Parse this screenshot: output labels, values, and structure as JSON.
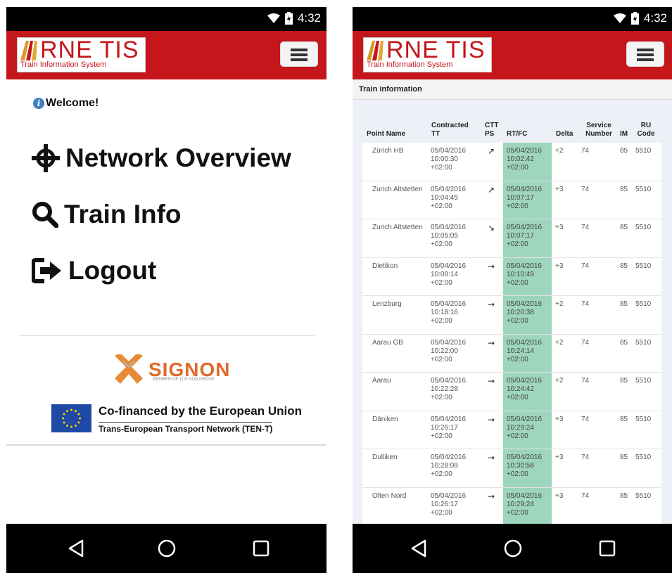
{
  "status": {
    "time": "4:32"
  },
  "logo": {
    "title": "RNE TIS",
    "subtitle": "Train Information System"
  },
  "left": {
    "welcome": "Welcome!",
    "menu": [
      {
        "label": "Network Overview",
        "icon": "crosshair-icon"
      },
      {
        "label": "Train Info",
        "icon": "search-icon"
      },
      {
        "label": "Logout",
        "icon": "logout-icon"
      }
    ],
    "sponsor": {
      "name": "SIGNON",
      "tagline": "MEMBER OF TÜV SÜD GROUP"
    },
    "eu": {
      "line1": "Co-financed by the European Union",
      "line2": "Trans-European Transport Network (TEN-T)"
    }
  },
  "right": {
    "section_title": "Train information",
    "headers": {
      "point": "Point Name",
      "contracted": "Contracted TT",
      "ctt": "CTT PS",
      "rtfc": "RT/FC",
      "delta": "Delta",
      "service": "Service Number",
      "im": "IM",
      "ru": "RU Code"
    },
    "rows": [
      {
        "point": "Zürich HB",
        "ctt_date": "05/04/2016",
        "ctt_time": "10:00:30",
        "ctt_tz": "+02:00",
        "arrow": "↗",
        "rt": "05/04/2016\n10:02:42\n+02:00",
        "delta": "+2",
        "service": "74",
        "im": "85",
        "ru": "5510"
      },
      {
        "point": "Zurich Altstetten",
        "ctt_date": "05/04/2016",
        "ctt_time": "10:04:45",
        "ctt_tz": "+02:00",
        "arrow": "↗",
        "rt": "05/04/2016\n10:07:17\n+02:00",
        "delta": "+3",
        "service": "74",
        "im": "85",
        "ru": "5510"
      },
      {
        "point": "Zurich Altstetten",
        "ctt_date": "05/04/2016",
        "ctt_time": "10:05:05",
        "ctt_tz": "+02:00",
        "arrow": "↘",
        "rt": "05/04/2016\n10:07:17\n+02:00",
        "delta": "+3",
        "service": "74",
        "im": "85",
        "ru": "5510"
      },
      {
        "point": "Dietikon",
        "ctt_date": "05/04/2016",
        "ctt_time": "10:08:14",
        "ctt_tz": "+02:00",
        "arrow": "→",
        "rt": "05/04/2016\n10:10:49\n+02:00",
        "delta": "+3",
        "service": "74",
        "im": "85",
        "ru": "5510"
      },
      {
        "point": "Lenzburg",
        "ctt_date": "05/04/2016",
        "ctt_time": "10:18:16",
        "ctt_tz": "+02:00",
        "arrow": "→",
        "rt": "05/04/2016\n10:20:38\n+02:00",
        "delta": "+2",
        "service": "74",
        "im": "85",
        "ru": "5510"
      },
      {
        "point": "Aarau GB",
        "ctt_date": "05/04/2016",
        "ctt_time": "10:22:00",
        "ctt_tz": "+02:00",
        "arrow": "→",
        "rt": "05/04/2016\n10:24:14\n+02:00",
        "delta": "+2",
        "service": "74",
        "im": "85",
        "ru": "5510"
      },
      {
        "point": "Aarau",
        "ctt_date": "05/04/2016",
        "ctt_time": "10:22:28",
        "ctt_tz": "+02:00",
        "arrow": "→",
        "rt": "05/04/2016\n10:24:42\n+02:00",
        "delta": "+2",
        "service": "74",
        "im": "85",
        "ru": "5510"
      },
      {
        "point": "Däniken",
        "ctt_date": "05/04/2016",
        "ctt_time": "10:26:17",
        "ctt_tz": "+02:00",
        "arrow": "→",
        "rt": "05/04/2016\n10:29:24\n+02:00",
        "delta": "+3",
        "service": "74",
        "im": "85",
        "ru": "5510"
      },
      {
        "point": "Dulliken",
        "ctt_date": "05/04/2016",
        "ctt_time": "10:28:09",
        "ctt_tz": "+02:00",
        "arrow": "→",
        "rt": "05/04/2016\n10:30:58\n+02:00",
        "delta": "+3",
        "service": "74",
        "im": "85",
        "ru": "5510"
      },
      {
        "point": "Olten Nord",
        "ctt_date": "05/04/2016",
        "ctt_time": "10:26:17",
        "ctt_tz": "+02:00",
        "arrow": "→",
        "rt": "05/04/2016\n10:29:24\n+02:00",
        "delta": "+3",
        "service": "74",
        "im": "85",
        "ru": "5510"
      }
    ]
  },
  "colors": {
    "brand_red": "#c4161b",
    "rt_green": "#9ed6bd",
    "table_bg": "#edf0f6"
  }
}
